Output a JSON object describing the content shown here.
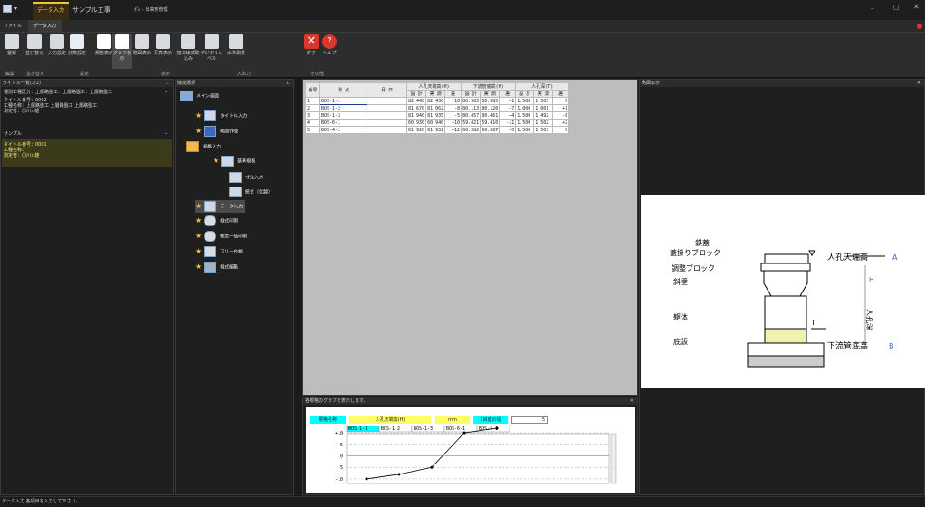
{
  "app": {
    "tabs": [
      "データ入力",
      "サンプル工事"
    ],
    "title": "ﾎﾟﾚ - 出来形管理"
  },
  "menu": [
    "ファイル",
    "データ入力"
  ],
  "ribbon": {
    "buttons": [
      "登録",
      "並び替え",
      "入力設定",
      "計算設定",
      "規格表示",
      "グラフ表示",
      "略図表示",
      "写真表示",
      "施工様式取込み",
      "デジタルレベル",
      "水準測量",
      "終了",
      "ヘルプ"
    ],
    "groups": [
      "編集",
      "並び替え",
      "設定",
      "表示",
      "入出力",
      "その他"
    ]
  },
  "title_list": {
    "header": "タイトル一覧(2/2)",
    "item1": {
      "line0": "種別工種区分：上層路盤工：上層路盤工：上層路盤工",
      "line1": "タイトル番号：0002",
      "line2": "工種名称：上層路盤工 上層路盤工 上層路盤工",
      "line3": "測定者：〇川×雄"
    },
    "group": "サンプル",
    "item2": {
      "line1": "タイトル番号：0001",
      "line2": "工種名称：",
      "line3": "測定者：〇川×雄"
    }
  },
  "nav": {
    "header": "機能選択",
    "items": [
      "メイン画面",
      "タイトル入力",
      "略図作成",
      "規格入力",
      "基準規格",
      "寸法入力",
      "統合（伏越）",
      "データ入力",
      "様式印刷",
      "帳票一括印刷",
      "フリー台帳",
      "様式編集"
    ]
  },
  "table": {
    "headers": {
      "no": "番号",
      "point": "測 点",
      "date": "月 日",
      "g1": "人孔天端高(H)",
      "g2": "下流管底高(H)",
      "g3": "人孔深(T)",
      "design": "設 計",
      "actual": "実 測",
      "diff": "差"
    },
    "rows": [
      {
        "no": "1",
        "point": "BOS-1-1",
        "d1": "82.440",
        "a1": "82.430",
        "f1": "-10",
        "d2": "80.983",
        "a2": "80.985",
        "f2": "+1",
        "d3": "1.500",
        "a3": "1.503",
        "f3": "0"
      },
      {
        "no": "2",
        "point": "BOS-1-2",
        "d1": "81.670",
        "a1": "81.062",
        "f1": "-8",
        "d2": "80.113",
        "a2": "80.120",
        "f2": "+7",
        "d3": "1.000",
        "a3": "1.001",
        "f3": "+1"
      },
      {
        "no": "3",
        "point": "BOS-1-3",
        "d1": "81.940",
        "a1": "81.935",
        "f1": "-5",
        "d2": "80.457",
        "a2": "80.461",
        "f2": "+4",
        "d3": "1.500",
        "a3": "1.492",
        "f3": "-8"
      },
      {
        "no": "4",
        "point": "BOS-6-1",
        "d1": "60.930",
        "a1": "60.940",
        "f1": "+10",
        "d2": "59.421",
        "a2": "59.410",
        "f2": "-11",
        "d3": "1.500",
        "a3": "1.502",
        "f3": "+2"
      },
      {
        "no": "5",
        "point": "BOS-4-1",
        "d1": "61.920",
        "a1": "61.932",
        "f1": "+12",
        "d2": "60.382",
        "a2": "60.387",
        "f2": "+5",
        "d3": "1.500",
        "a3": "1.503",
        "f3": "0"
      }
    ]
  },
  "graph": {
    "header": "各規格のグラフを表示します。",
    "spec_label": "規格名称",
    "spec_value": "人孔天端高(H)",
    "unit": "mm",
    "interval_label": "1目盛の幅",
    "interval_value": "5",
    "points": [
      "BOS-1-1",
      "BOS-1-2",
      "BOS-1-3",
      "BOS-6-1",
      "BOS-4-1"
    ],
    "yticks": [
      "+10",
      "+5",
      "0",
      "-5",
      "-10"
    ]
  },
  "chart_data": {
    "type": "line",
    "categories": [
      "BOS-1-1",
      "BOS-1-2",
      "BOS-1-3",
      "BOS-6-1",
      "BOS-4-1"
    ],
    "values": [
      -10,
      -8,
      -5,
      10,
      12
    ],
    "title": "人孔天端高(H)",
    "ylim": [
      -12,
      12
    ]
  },
  "diagram": {
    "header": "略図表示",
    "labels": {
      "l1": "鉄蓋",
      "l2": "蓋掛りブロック",
      "l3": "調整ブロック",
      "l4": "斜壁",
      "l5": "躯体",
      "l6": "底版",
      "r1": "人孔天端高",
      "r1tag": "A",
      "r2": "下流管底高",
      "r2tag": "B",
      "v": "人孔深",
      "vtag": "H",
      "t": "T"
    }
  },
  "status": "データ入力 各項目を入力して下さい。",
  "colors": {
    "accent": "#f4c430",
    "selection": "#1e3b8c",
    "yellow": "#ffff66",
    "cyan": "#00ffff"
  }
}
